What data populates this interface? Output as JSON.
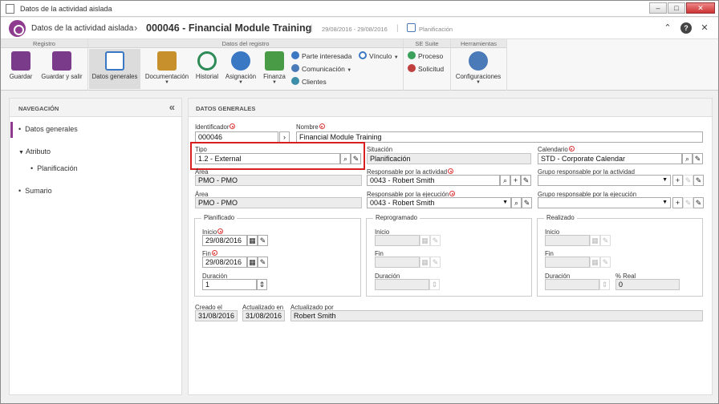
{
  "window": {
    "title": "Datos de la actividad aislada"
  },
  "header": {
    "title": "Datos de la actividad aislada",
    "record": "000046 - Financial Module Training",
    "dates": "29/08/2016 - 29/08/2016",
    "status": "Planificación"
  },
  "ribbon": {
    "groups": {
      "registro": "Registro",
      "datos": "Datos del registro",
      "suite": "SE Suite",
      "herr": "Herramientas"
    },
    "guardar": "Guardar",
    "guardar_salir": "Guardar y salir",
    "datos_generales": "Datos generales",
    "documentacion": "Documentación",
    "historial": "Historial",
    "asignacion": "Asignación",
    "finanza": "Finanza",
    "parte": "Parte interesada",
    "vinculo": "Vínculo",
    "comunicacion": "Comunicación",
    "clientes": "Clientes",
    "proceso": "Proceso",
    "solicitud": "Solicitud",
    "configuraciones": "Configuraciones"
  },
  "nav": {
    "title": "NAVEGACIÓN",
    "items": [
      "Datos generales",
      "Atributo",
      "Planificación",
      "Sumario"
    ]
  },
  "form": {
    "title": "DATOS GENERALES",
    "identificador_label": "Identificador",
    "identificador": "000046",
    "nombre_label": "Nombre",
    "nombre": "Financial Module Training",
    "tipo_label": "Tipo",
    "tipo": "1.2 - External",
    "situacion_label": "Situación",
    "situacion": "Planificación",
    "calendario_label": "Calendario",
    "calendario": "STD - Corporate Calendar",
    "area1_label": "Área",
    "area1": "PMO - PMO",
    "resp_act_label": "Responsable por la actividad",
    "resp_act": "0043 - Robert Smith",
    "grupo_act_label": "Grupo responsable por la actividad",
    "area2_label": "Área",
    "area2": "PMO - PMO",
    "resp_ej_label": "Responsable por la ejecución",
    "resp_ej": "0043 - Robert Smith",
    "grupo_ej_label": "Grupo responsable por la ejecución",
    "planificado": {
      "title": "Planificado",
      "inicio_label": "Inicio",
      "inicio": "29/08/2016",
      "fin_label": "Fin",
      "fin": "29/08/2016",
      "duracion_label": "Duración",
      "duracion": "1"
    },
    "reprogramado": {
      "title": "Reprogramado",
      "inicio_label": "Inicio",
      "fin_label": "Fin",
      "duracion_label": "Duración"
    },
    "realizado": {
      "title": "Realizado",
      "inicio_label": "Inicio",
      "fin_label": "Fin",
      "duracion_label": "Duración",
      "real_label": "% Real",
      "real": "0"
    },
    "creado_label": "Creado el",
    "creado": "31/08/2016",
    "actualizado_label": "Actualizado en",
    "actualizado": "31/08/2016",
    "actualizado_por_label": "Actualizado por",
    "actualizado_por": "Robert Smith"
  }
}
